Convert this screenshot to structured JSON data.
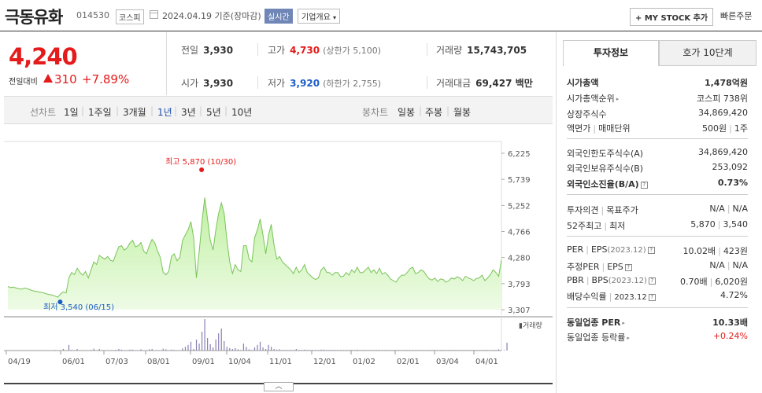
{
  "header": {
    "name": "극동유화",
    "code": "014530",
    "market": "코스피",
    "date": "2024.04.19",
    "date_basis": "기준(장마감)",
    "realtime": "실시간",
    "overview": "기업개요",
    "mystock": "+ MY STOCK 추가",
    "quick_order": "빠른주문"
  },
  "price": {
    "current": "4,240",
    "change_label": "전일대비",
    "change": "310",
    "change_pct": "+7.89%"
  },
  "stats": {
    "prev_label": "전일",
    "prev": "3,930",
    "high_label": "고가",
    "high": "4,730",
    "upper_limit": "(상한가 5,100)",
    "volume_label": "거래량",
    "volume": "15,743,705",
    "open_label": "시가",
    "open": "3,930",
    "low_label": "저가",
    "low": "3,920",
    "lower_limit": "(하한가 2,755)",
    "amount_label": "거래대금",
    "amount": "69,427 백만"
  },
  "tabs": {
    "line_chart": "선차트",
    "periods": [
      "1일",
      "1주일",
      "3개월",
      "1년",
      "3년",
      "5년",
      "10년"
    ],
    "candle_chart": "봉차트",
    "candles": [
      "일봉",
      "주봉",
      "월봉"
    ]
  },
  "panel": {
    "tab_invest": "투자정보",
    "tab_orderbook": "호가 10단계",
    "market_cap_label": "시가총액",
    "market_cap": "1,478억원",
    "cap_rank_label": "시가총액순위",
    "cap_rank": "코스피 738위",
    "shares_label": "상장주식수",
    "shares": "34,869,420",
    "par_label": "액면가",
    "unit_label": "매매단위",
    "par": "500원",
    "unit": "1주",
    "foreign_limit_label": "외국인한도주식수(A)",
    "foreign_limit": "34,869,420",
    "foreign_hold_label": "외국인보유주식수(B)",
    "foreign_hold": "253,092",
    "foreign_ratio_label": "외국인소진율(B/A)",
    "foreign_ratio": "0.73%",
    "opinion_label": "투자의견",
    "target_label": "목표주가",
    "opinion": "N/A",
    "target": "N/A",
    "wk52_high_label": "52주최고",
    "wk52_low_label": "최저",
    "wk52_high": "5,870",
    "wk52_low": "3,540",
    "per_label": "PER",
    "eps_label": "EPS",
    "per_eps_year": "(2023.12)",
    "per": "10.02배",
    "eps": "423원",
    "est_per_label": "추정PER",
    "est_eps_label": "EPS",
    "est_per": "N/A",
    "est_eps": "N/A",
    "pbr_label": "PBR",
    "bps_label": "BPS",
    "pbr_bps_year": "(2023.12)",
    "pbr": "0.70배",
    "bps": "6,020원",
    "div_label": "배당수익률",
    "div_year": "2023.12",
    "div": "4.72%",
    "sector_per_label": "동일업종 PER",
    "sector_per": "10.33배",
    "sector_chg_label": "동일업종 등락률",
    "sector_chg": "+0.24%"
  },
  "chart_data": {
    "type": "area",
    "y_ticks": [
      "6,225",
      "5,739",
      "5,252",
      "4,766",
      "4,280",
      "3,793",
      "3,307"
    ],
    "ylim": [
      3307,
      6225
    ],
    "x_ticks": [
      "04/19",
      "06/01",
      "07/03",
      "08/01",
      "09/01",
      "10/04",
      "11/01",
      "12/01",
      "01/02",
      "02/01",
      "03/04",
      "04/01"
    ],
    "high_label": "최고 5,870 (10/30)",
    "low_label": "최저 3,540 (06/15)",
    "volume_label": "거래량",
    "series": [
      {
        "values": [
          3740,
          3720,
          3730,
          3710,
          3700,
          3690,
          3710,
          3700,
          3680,
          3660,
          3650,
          3640,
          3630,
          3620,
          3600,
          3590,
          3580,
          3560,
          3540,
          3600,
          3640,
          3620,
          3900,
          4000,
          3960,
          4080,
          4000,
          3950,
          4020,
          3900,
          4050,
          4200,
          4150,
          4320,
          4280,
          4250,
          4300,
          4230,
          4210,
          4350,
          4480,
          4500,
          4420,
          4460,
          4550,
          4600,
          4480,
          4500,
          4560,
          4400,
          4350,
          4500,
          4620,
          4550,
          4400,
          4280,
          4000,
          3960,
          4020,
          4300,
          4350,
          4220,
          4280,
          4600,
          4700,
          4800,
          4950,
          4650,
          3900,
          4400,
          4950,
          5400,
          5000,
          4600,
          4420,
          4800,
          5100,
          5300,
          5100,
          4600,
          4200,
          3980,
          4150,
          4050,
          4020,
          4500,
          4500,
          4250,
          4200,
          4650,
          4800,
          5000,
          4700,
          4350,
          4700,
          4900,
          4500,
          4250,
          4300,
          4200,
          4150,
          4100,
          4050,
          3980,
          4100,
          4000,
          4050,
          4150,
          4000,
          3950,
          3900,
          3870,
          3900,
          4050,
          4100,
          4000,
          4000,
          3950,
          4000,
          4000,
          3920,
          3930,
          4000,
          3950,
          4050,
          4000,
          4100,
          4000,
          4000,
          4050,
          4100,
          4000,
          4050,
          3980,
          4080,
          3970,
          4000,
          3950,
          3880,
          3850,
          3820,
          3900,
          3950,
          3950,
          4000,
          4070,
          4100,
          3980,
          4000,
          4050,
          4020,
          3940,
          3880,
          3860,
          3900,
          3830,
          3880,
          3870,
          3820,
          3850,
          3900,
          3880,
          3920,
          3900,
          3850,
          3930,
          3900,
          3880,
          3850,
          3890,
          3900,
          3950,
          3850,
          3900,
          3960,
          4050,
          4000,
          3930,
          4240
        ]
      }
    ],
    "volume_peaks": [
      0.0,
      0.0,
      0.0,
      0.0,
      0.0,
      0.0,
      0.0,
      0.0,
      0.0,
      0.0,
      0.0,
      0.0,
      0.0,
      0.0,
      0.0,
      0.0,
      0.0,
      0.02,
      0.0,
      0.0,
      0.05,
      0.0,
      0.18,
      0.02,
      0.0,
      0.05,
      0.0,
      0.0,
      0.0,
      0.0,
      0.02,
      0.06,
      0.0,
      0.05,
      0.0,
      0.0,
      0.0,
      0.0,
      0.0,
      0.02,
      0.05,
      0.03,
      0.0,
      0.0,
      0.03,
      0.03,
      0.0,
      0.0,
      0.04,
      0.0,
      0.0,
      0.04,
      0.05,
      0.0,
      0.0,
      0.0,
      0.06,
      0.04,
      0.0,
      0.03,
      0.02,
      0.0,
      0.0,
      0.07,
      0.12,
      0.18,
      0.28,
      0.05,
      0.35,
      0.22,
      0.6,
      1.0,
      0.4,
      0.2,
      0.1,
      0.35,
      0.55,
      0.7,
      0.3,
      0.12,
      0.08,
      0.05,
      0.08,
      0.04,
      0.02,
      0.22,
      0.12,
      0.04,
      0.02,
      0.1,
      0.18,
      0.28,
      0.1,
      0.05,
      0.18,
      0.12,
      0.05,
      0.03,
      0.04,
      0.02,
      0.02,
      0.02,
      0.02,
      0.02,
      0.05,
      0.02,
      0.02,
      0.03,
      0.02,
      0.02,
      0.02,
      0.02,
      0.02,
      0.03,
      0.03,
      0.02,
      0.02,
      0.02,
      0.02,
      0.02,
      0.02,
      0.02,
      0.02,
      0.02,
      0.02,
      0.02,
      0.03,
      0.02,
      0.02,
      0.02,
      0.02,
      0.02,
      0.02,
      0.02,
      0.02,
      0.02,
      0.02,
      0.02,
      0.02,
      0.02,
      0.02,
      0.02,
      0.02,
      0.02,
      0.02,
      0.02,
      0.02,
      0.02,
      0.02,
      0.02,
      0.02,
      0.02,
      0.02,
      0.02,
      0.02,
      0.02,
      0.02,
      0.02,
      0.02,
      0.02,
      0.02,
      0.02,
      0.02,
      0.02,
      0.02,
      0.02,
      0.02,
      0.02,
      0.02,
      0.02,
      0.02,
      0.02,
      0.02,
      0.02,
      0.02,
      0.02,
      0.02,
      0.04,
      0.02,
      0.02,
      0.25
    ]
  }
}
